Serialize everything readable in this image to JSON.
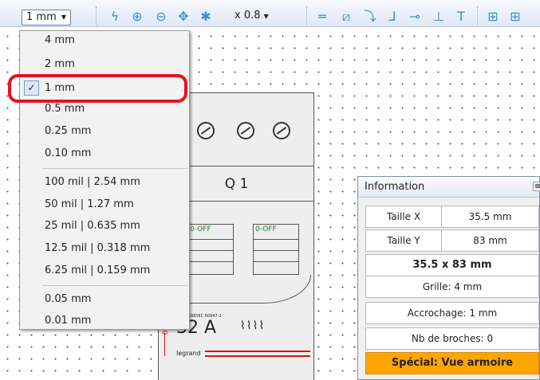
{
  "toolbar": {
    "grid_value": "1 mm",
    "zoom_factor": "x 0.8"
  },
  "menu": {
    "group1": [
      "4 mm",
      "2 mm",
      "1 mm",
      "0.5 mm",
      "0.25 mm",
      "0.10 mm"
    ],
    "group2": [
      "100 mil | 2.54 mm",
      "50 mil | 1.27 mm",
      "25 mil | 0.635 mm",
      "12.5 mil | 0.318 mm",
      "6.25 mil | 0.159 mm"
    ],
    "group3": [
      "0.05 mm",
      "0.01 mm"
    ],
    "selected": "1 mm"
  },
  "component": {
    "label": "Q 1",
    "switch_left": "0-OFF",
    "switch_right": "0-OFF",
    "rating": "32 A",
    "brand": "legrand",
    "code": "043",
    "standard_text": "EN 60898/IEC 60947-2"
  },
  "info": {
    "title": "Information",
    "size_x_label": "Taille X",
    "size_x_value": "35.5 mm",
    "size_y_label": "Taille Y",
    "size_y_value": "83 mm",
    "dimensions": "35.5 x 83 mm",
    "grid": "Grille: 4 mm",
    "snap": "Accrochage: 1 mm",
    "pins": "Nb de broches: 0",
    "special": "Spécial: Vue armoire"
  },
  "colors": {
    "highlight": "#e0151d",
    "special_bg": "#ffa500"
  }
}
